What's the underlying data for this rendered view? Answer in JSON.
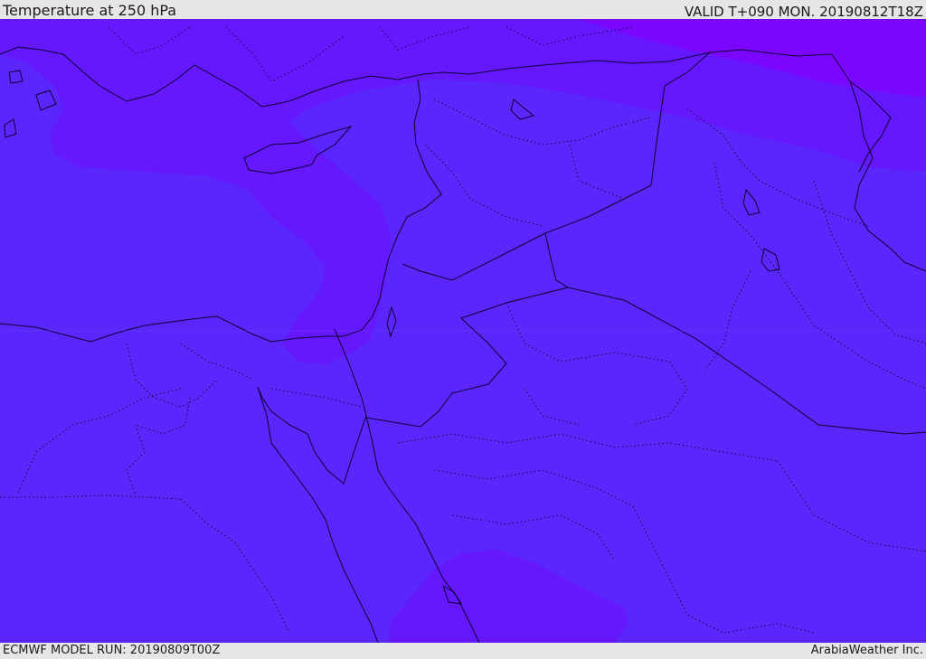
{
  "header": {
    "title": "Temperature at 250 hPa",
    "valid_time": "VALID T+090 MON. 20190812T18Z"
  },
  "footer": {
    "model_run": "ECMWF MODEL RUN: 20190809T00Z",
    "credit": "ArabiaWeather Inc."
  },
  "colors": {
    "base_fill": "#5a26fc",
    "mid_fill": "#6518fd",
    "cold_fill": "#7a06fe",
    "coastline": "#0c0230",
    "border_dotted": "#14063c"
  }
}
